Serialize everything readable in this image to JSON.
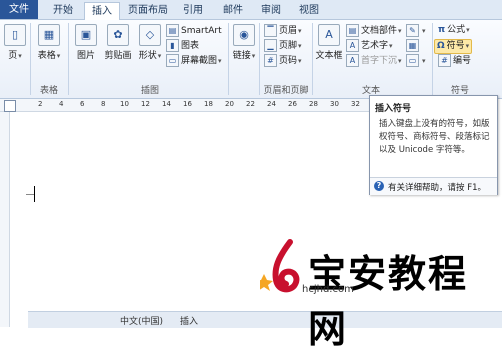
{
  "tabs": {
    "file": "文件",
    "home": "开始",
    "insert": "插入",
    "layout": "页面布局",
    "references": "引用",
    "mailings": "邮件",
    "review": "审阅",
    "view": "视图"
  },
  "ribbon": {
    "page": "页",
    "table": "表格",
    "picture": "图片",
    "clipart": "剪贴画",
    "shapes": "形状",
    "smartart": "SmartArt",
    "chart": "图表",
    "screenshot": "屏幕截图",
    "link": "链接",
    "header": "页眉",
    "footer": "页脚",
    "page_number": "页码",
    "textbox": "文本框",
    "docparts": "文档部件",
    "wordart": "艺术字",
    "dropcap": "首字下沉",
    "formula": "公式",
    "symbol": "符号",
    "numbering": "编号",
    "groups": {
      "table": "表格",
      "illustrations": "插图",
      "header_footer": "页眉和页脚",
      "text": "文本",
      "symbols": "符号"
    }
  },
  "ruler": {
    "numbers": [
      "2",
      "4",
      "6",
      "8",
      "10",
      "12",
      "14",
      "16",
      "18",
      "20",
      "22",
      "24",
      "26",
      "28",
      "30",
      "32"
    ]
  },
  "tooltip": {
    "title": "插入符号",
    "body": "插入键盘上没有的符号，如版权符号、商标符号、段落标记以及 Unicode 字符等。",
    "help": "有关详细帮助，请按 F1。"
  },
  "status": {
    "language": "中文(中国)",
    "mode": "插入"
  },
  "watermark": {
    "text": "宝安教程网",
    "url": "hcjhd.com"
  },
  "colors": {
    "file_tab": "#2a5699",
    "symbol_highlight": "#fde9a8"
  }
}
